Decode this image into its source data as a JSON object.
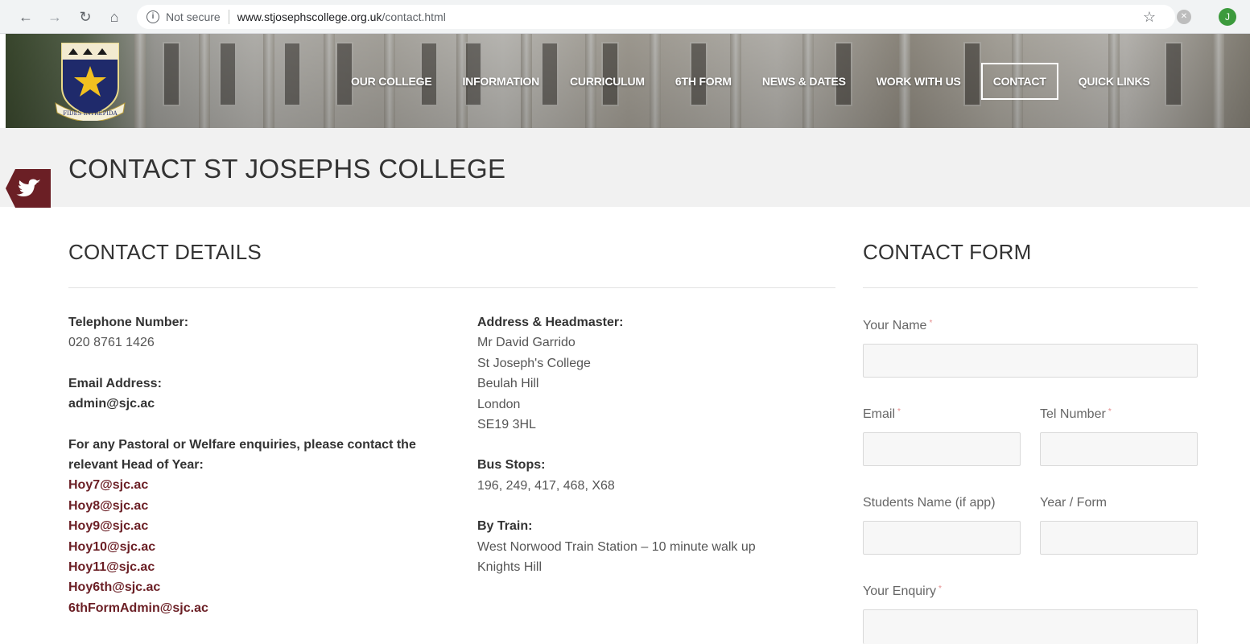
{
  "browser": {
    "security_label": "Not secure",
    "url_domain": "www.stjosephscollege.org.uk",
    "url_path": "/contact.html",
    "profile_initial": "J",
    "icons": [
      "back-arrow-icon",
      "forward-arrow-icon",
      "reload-icon",
      "home-icon",
      "info-icon",
      "star-icon",
      "extension-icon"
    ]
  },
  "header": {
    "crest_motto": "FIDES INTREPIDA",
    "nav": [
      {
        "label": "OUR COLLEGE"
      },
      {
        "label": "INFORMATION"
      },
      {
        "label": "CURRICULUM"
      },
      {
        "label": "6TH FORM"
      },
      {
        "label": "NEWS & DATES"
      },
      {
        "label": "WORK WITH US"
      },
      {
        "label": "CONTACT",
        "active": true
      },
      {
        "label": "QUICK LINKS"
      }
    ]
  },
  "page": {
    "title": "CONTACT ST JOSEPHS COLLEGE",
    "brand_color": "#6b1f25"
  },
  "details": {
    "heading": "CONTACT DETAILS",
    "telephone_label": "Telephone Number:",
    "telephone_value": "020 8761 1426",
    "email_label": "Email Address:",
    "email_value": "admin@sjc.ac",
    "pastoral_text": "For any Pastoral or Welfare enquiries, please contact the relevant Head of Year:",
    "year_emails": [
      "Hoy7@sjc.ac",
      "Hoy8@sjc.ac",
      "Hoy9@sjc.ac",
      "Hoy10@sjc.ac",
      "Hoy11@sjc.ac",
      "Hoy6th@sjc.ac",
      "6thFormAdmin@sjc.ac"
    ],
    "address_label": "Address & Headmaster:",
    "address_lines": [
      "Mr David Garrido",
      "St Joseph's College",
      "Beulah Hill",
      "London",
      "SE19 3HL"
    ],
    "bus_label": "Bus Stops:",
    "bus_value": "196, 249, 417, 468, X68",
    "train_label": "By Train:",
    "train_value": "West Norwood Train Station – 10 minute walk up Knights Hill"
  },
  "form": {
    "heading": "CONTACT FORM",
    "name_label": "Your Name",
    "email_label": "Email",
    "tel_label": "Tel Number",
    "student_label": "Students Name (if app)",
    "year_label": "Year / Form",
    "enquiry_label": "Your Enquiry",
    "required_mark": "*"
  }
}
